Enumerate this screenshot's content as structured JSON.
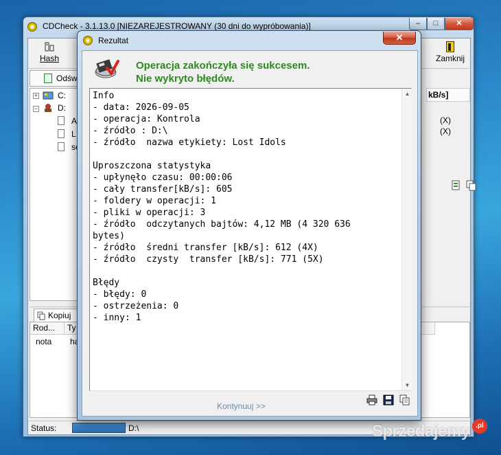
{
  "main_window": {
    "title": "CDCheck - 3.1.13.0 [NIEZAREJESTROWANY (30 dni do wypróbowania)]",
    "caption_buttons": {
      "minimize": "–",
      "maximize": "□",
      "close": "✕"
    },
    "toolbar": {
      "hash_label": "Hash",
      "close_label": "Zamknij"
    },
    "refresh_label": "Odśwież",
    "tree": {
      "drives": [
        "C:",
        "D:"
      ],
      "files": [
        "A",
        "L",
        "se"
      ]
    },
    "right_panel": {
      "header": "kB/s]",
      "rows": [
        "(X)",
        "(X)"
      ]
    },
    "bottom_tab": "Kopiuj",
    "list_columns": [
      "Rod...",
      "Ty"
    ],
    "list_row": [
      "nota",
      "ha"
    ],
    "status": {
      "label": "Status:",
      "path": "D:\\"
    }
  },
  "dialog": {
    "title": "Rezultat",
    "close": "✕",
    "headline_1": "Operacja zakończyła się sukcesem.",
    "headline_2": "Nie wykryto błędów.",
    "report_lines": [
      "Info",
      "- data: 2026-09-05",
      "- operacja: Kontrola",
      "- źródło : D:\\",
      "- źródło  nazwa etykiety: Lost Idols",
      "",
      "Uproszczona statystyka",
      "- upłynęło czasu: 00:00:06",
      "- cały transfer[kB/s]: 605",
      "- foldery w operacji: 1",
      "- pliki w operacji: 3",
      "- źródło  odczytanych bajtów: 4,12 MB (4 320 636",
      "bytes)",
      "- źródło  średni transfer [kB/s]: 612 (4X)",
      "- źródło  czysty  transfer [kB/s]: 771 (5X)",
      "",
      "Błędy",
      "- błędy: 0",
      "- ostrzeżenia: 0",
      "- inny: 1"
    ],
    "continue_label": "Kontynuuj >>",
    "tools": [
      "print-icon",
      "save-icon",
      "copy-icon"
    ]
  },
  "watermark": {
    "text": "Sprzedajemy",
    "badge": ".pl"
  },
  "colors": {
    "success_green": "#2c8a1e",
    "continue_link": "#6a8ba8"
  }
}
